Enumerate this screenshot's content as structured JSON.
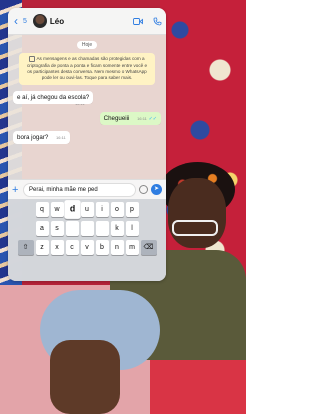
{
  "header": {
    "back_count": "5",
    "contact_name": "Léo"
  },
  "date_chip": "Hoje",
  "encryption_notice": "As mensagens e as chamadas são protegidas com a criptografia de ponta a ponta e ficam somente entre você e os participantes desta conversa. Nem mesmo o WhatsApp pode ler ou ouvi-las. Toque para saber mais.",
  "messages": [
    {
      "text": "e aí, já chegou da escola?",
      "time": "16:11",
      "direction": "in"
    },
    {
      "text": "Chegueiii",
      "time": "16:11",
      "direction": "out"
    },
    {
      "text": "bora jogar?",
      "time": "16:11",
      "direction": "in"
    }
  ],
  "compose": {
    "value": "Perai, minha mãe me ped"
  },
  "keyboard": {
    "row1": [
      "q",
      "w",
      "d",
      "u",
      "i",
      "o",
      "p"
    ],
    "row2": [
      "a",
      "s",
      "k",
      "l"
    ],
    "row3": [
      "z",
      "x",
      "c",
      "v",
      "b",
      "n",
      "m"
    ]
  },
  "colors": {
    "accent": "#2f7de1",
    "outgoing_bubble": "#dcf8c6",
    "encryption_bg": "#fff3c4"
  },
  "icons": [
    "back-icon",
    "video-icon",
    "phone-icon",
    "lock-icon",
    "plus-icon",
    "sticker-icon",
    "send-icon",
    "shift-icon",
    "backspace-icon",
    "check-icon"
  ]
}
